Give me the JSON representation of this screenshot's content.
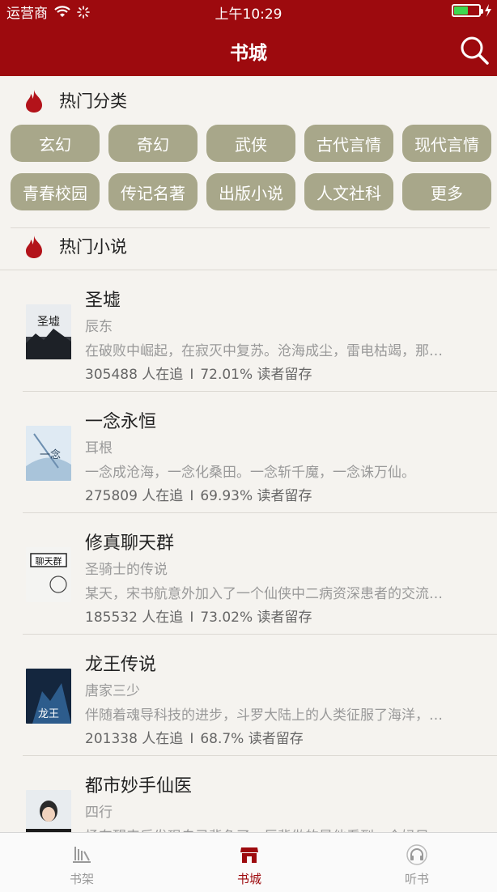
{
  "status_bar": {
    "carrier": "运营商",
    "time": "上午10:29"
  },
  "nav": {
    "title": "书城"
  },
  "hot_categories": {
    "title": "热门分类",
    "items": [
      "玄幻",
      "奇幻",
      "武侠",
      "古代言情",
      "现代言情",
      "青春校园",
      "传记名著",
      "出版小说",
      "人文社科",
      "更多"
    ]
  },
  "hot_novels": {
    "title": "热门小说",
    "books": [
      {
        "title": "圣墟",
        "author": "辰东",
        "desc": "在破败中崛起，在寂灭中复苏。沧海成尘，雷电枯竭，那…",
        "followers": "305488 人在追",
        "retention": "72.01% 读者留存"
      },
      {
        "title": "一念永恒",
        "author": "耳根",
        "desc": "一念成沧海，一念化桑田。一念斩千魔，一念诛万仙。",
        "followers": "275809 人在追",
        "retention": "69.93% 读者留存"
      },
      {
        "title": "修真聊天群",
        "author": "圣骑士的传说",
        "desc": "某天，宋书航意外加入了一个仙侠中二病资深患者的交流…",
        "followers": "185532 人在追",
        "retention": "73.02% 读者留存"
      },
      {
        "title": "龙王传说",
        "author": "唐家三少",
        "desc": "伴随着魂导科技的进步，斗罗大陆上的人类征服了海洋，…",
        "followers": "201338 人在追",
        "retention": "68.7% 读者留存"
      },
      {
        "title": "都市妙手仙医",
        "author": "四行",
        "desc": "杨东醒来后发现自己背负了一巨背做的是他看到一个妈目",
        "followers": "",
        "retention": ""
      }
    ]
  },
  "tabs": [
    {
      "label": "书架",
      "icon": "bookshelf-icon",
      "active": false
    },
    {
      "label": "书城",
      "icon": "store-icon",
      "active": true
    },
    {
      "label": "听书",
      "icon": "headphones-icon",
      "active": false
    }
  ],
  "colors": {
    "brand": "#9d0a0e",
    "pill": "#a8a78a",
    "background": "#f5f3ef"
  }
}
